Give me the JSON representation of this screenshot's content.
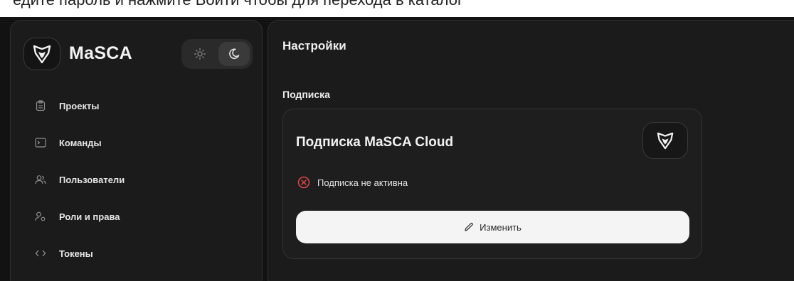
{
  "header_strip_text": "едите пароль и нажмите Войти чтобы для перехода в каталог",
  "brand": {
    "name": "MaSCA",
    "logo_icon": "masca-shield-icon"
  },
  "theme_toggle": {
    "options": [
      "light",
      "dark"
    ],
    "selected": "dark"
  },
  "sidebar": {
    "items": [
      {
        "label": "Проекты",
        "icon": "clipboard-icon"
      },
      {
        "label": "Команды",
        "icon": "terminal-icon"
      },
      {
        "label": "Пользователи",
        "icon": "users-icon"
      },
      {
        "label": "Роли и права",
        "icon": "user-key-icon"
      },
      {
        "label": "Токены",
        "icon": "code-brackets-icon"
      }
    ]
  },
  "main": {
    "title": "Настройки",
    "section_title": "Подписка",
    "card": {
      "title": "Подписка MaSCA Cloud",
      "status_text": "Подписка не активна",
      "status_icon": "x-circle-icon",
      "edit_label": "Изменить",
      "edit_icon": "pencil-icon"
    }
  },
  "colors": {
    "background": "#121212",
    "panel": "#1b1b1b",
    "status_error": "#e04848",
    "button_bg": "#f4f4f4"
  }
}
